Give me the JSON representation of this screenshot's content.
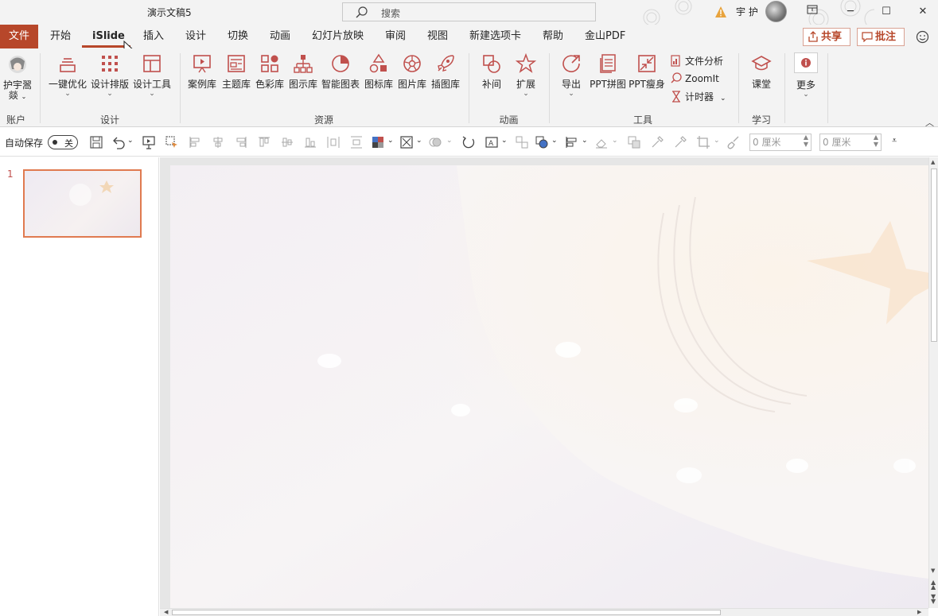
{
  "titlebar": {
    "doc_title": "演示文稿5",
    "search_placeholder": "搜索",
    "user_name": "宇 护"
  },
  "tabs": {
    "file": "文件",
    "items": [
      "开始",
      "iSlide",
      "插入",
      "设计",
      "切换",
      "动画",
      "幻灯片放映",
      "审阅",
      "视图",
      "新建选项卡",
      "帮助",
      "金山PDF"
    ],
    "active": "iSlide",
    "share": "共享",
    "comment": "批注"
  },
  "ribbon": {
    "account": {
      "label": "护宇翯\n燚",
      "line1": "护宇翯",
      "line2": "燚",
      "group": "账户"
    },
    "design": {
      "group": "设计",
      "items": [
        "一键优化",
        "设计排版",
        "设计工具"
      ]
    },
    "resources": {
      "group": "资源",
      "items": [
        "案例库",
        "主题库",
        "色彩库",
        "图示库",
        "智能图表",
        "图标库",
        "图片库",
        "插图库"
      ]
    },
    "animation": {
      "group": "动画",
      "items": [
        "补间",
        "扩展"
      ]
    },
    "tools": {
      "group": "工具",
      "items": [
        "导出",
        "PPT拼图",
        "PPT瘦身"
      ],
      "small": [
        "文件分析",
        "ZoomIt",
        "计时器"
      ]
    },
    "learn": {
      "group": "学习",
      "items": [
        "课堂"
      ]
    },
    "more": {
      "label": "更多"
    }
  },
  "qat": {
    "autosave": "自动保存",
    "toggle": "关",
    "width_value": "0 厘米",
    "height_value": "0 厘米"
  },
  "slides": {
    "current": "1"
  },
  "colors": {
    "accent": "#b7472a",
    "ribbon_bg": "#f3f3f3",
    "icon": "#c0504d"
  }
}
